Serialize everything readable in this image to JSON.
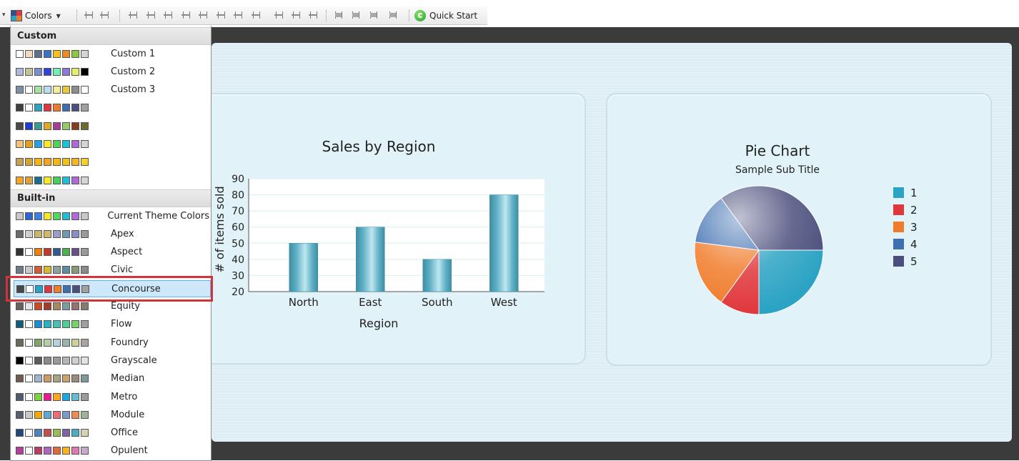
{
  "toolbar": {
    "colors_label": "Colors",
    "quick_start_label": "Quick Start"
  },
  "color_menu": {
    "custom_header": "Custom",
    "builtin_header": "Built-in",
    "custom": [
      {
        "label": "Custom 1",
        "colors": [
          "#ffffff",
          "#f5d9bd",
          "#5d7088",
          "#3a75c4",
          "#f5c21b",
          "#f08a22",
          "#8dc63f",
          "#d4d4d4"
        ]
      },
      {
        "label": "Custom 2",
        "colors": [
          "#b1b9d9",
          "#c3c39a",
          "#7a8fc7",
          "#2d44d7",
          "#6ff0b7",
          "#8e79d9",
          "#e5ef6b",
          "#000000"
        ]
      },
      {
        "label": "Custom 3",
        "colors": [
          "#7b8fa6",
          "#ffffff",
          "#a6e2a1",
          "#b8dff0",
          "#f3ee9a",
          "#e6c93f",
          "#8d8d8d",
          "#ffffff"
        ]
      },
      {
        "label": "",
        "colors": [
          "#404040",
          "#ffffff",
          "#2ba4c4",
          "#e0373c",
          "#f07c2b",
          "#3d6eb0",
          "#4c4f7d",
          "#a0a0a0"
        ]
      },
      {
        "label": "",
        "colors": [
          "#4a4a4a",
          "#1c3bd1",
          "#3a9b93",
          "#e0a82b",
          "#a93c97",
          "#9bc96a",
          "#8a3b1b",
          "#6f6a2d"
        ]
      },
      {
        "label": "",
        "colors": [
          "#f4c37a",
          "#e0a020",
          "#26a2e2",
          "#f8e829",
          "#4fd35a",
          "#19c3d8",
          "#b068d8",
          "#d4d4d4"
        ]
      },
      {
        "label": "",
        "colors": [
          "#c8a055",
          "#cfa537",
          "#f2b313",
          "#f5a31e",
          "#f5b90e",
          "#f2c11b",
          "#f5b720",
          "#f3d12a"
        ]
      },
      {
        "label": "",
        "colors": [
          "#f5a623",
          "#e0a03a",
          "#1b6e8e",
          "#f6e829",
          "#42d15a",
          "#1fc0d6",
          "#b068d8",
          "#d4d4d4"
        ]
      }
    ],
    "builtin": [
      {
        "label": "Current Theme Colors",
        "colors": [
          "#c9c9c9",
          "#2c67d1",
          "#3b82e5",
          "#f5e62a",
          "#52d85e",
          "#1fbfd8",
          "#b26ad8",
          "#c9c9c9"
        ]
      },
      {
        "label": "Apex",
        "colors": [
          "#6b6b6b",
          "#cfcfcf",
          "#c9b56b",
          "#ceb96b",
          "#9a9ec9",
          "#6d9ab0",
          "#8a8fc8",
          "#9a9a9a"
        ]
      },
      {
        "label": "Aspect",
        "colors": [
          "#333333",
          "#ffffff",
          "#f07f0a",
          "#c0392b",
          "#2b5e8e",
          "#4bb34b",
          "#6b4f86",
          "#9a9a9a"
        ]
      },
      {
        "label": "Civic",
        "colors": [
          "#6f7b8a",
          "#c9c9c9",
          "#d05c3c",
          "#d6b72e",
          "#8aa3a0",
          "#5b8fa0",
          "#899a76",
          "#8a8a8a"
        ]
      },
      {
        "label": "Concourse",
        "colors": [
          "#464646",
          "#ffffff",
          "#2ba3c4",
          "#e0373c",
          "#f07c2b",
          "#3d6eb0",
          "#4c4f7d",
          "#a0a0a0"
        ]
      },
      {
        "label": "Equity",
        "colors": [
          "#6b5e5e",
          "#e6e6e6",
          "#d2481e",
          "#a83a2a",
          "#a78860",
          "#7c9c9e",
          "#9a6f6f",
          "#8a7a6a"
        ]
      },
      {
        "label": "Flow",
        "colors": [
          "#0e5f7a",
          "#ffffff",
          "#1a8fd0",
          "#25b2c9",
          "#44c3b9",
          "#4bcf93",
          "#7ad36a",
          "#a0a0a0"
        ]
      },
      {
        "label": "Foundry",
        "colors": [
          "#6a6a5a",
          "#ffffff",
          "#7fa56a",
          "#b3d0a5",
          "#b3d4db",
          "#9ab5a9",
          "#cfcf9a",
          "#a9a4a0"
        ]
      },
      {
        "label": "Grayscale",
        "colors": [
          "#000000",
          "#ffffff",
          "#5a5a5a",
          "#8a8a8a",
          "#9a9a9a",
          "#b5b5b5",
          "#cfcfcf",
          "#e3e3e3"
        ]
      },
      {
        "label": "Median",
        "colors": [
          "#6f5a4f",
          "#ffffff",
          "#9fb5c8",
          "#d29a62",
          "#a6a67c",
          "#cca36b",
          "#9c8a7a",
          "#7f9a9a"
        ]
      },
      {
        "label": "Metro",
        "colors": [
          "#4f5a6f",
          "#ffffff",
          "#7fd142",
          "#e81a8d",
          "#fba51a",
          "#1aa8e0",
          "#60bdd0",
          "#9a9a9a"
        ]
      },
      {
        "label": "Module",
        "colors": [
          "#5a5f6f",
          "#c9c9c9",
          "#f0a80a",
          "#5ea9d0",
          "#ef6a7a",
          "#7a9ac9",
          "#ef8a52",
          "#9ab59a"
        ]
      },
      {
        "label": "Office",
        "colors": [
          "#1f497d",
          "#ffffff",
          "#4f81bd",
          "#c0504d",
          "#9bbb59",
          "#8064a2",
          "#4bacc6",
          "#d9d2b0"
        ]
      },
      {
        "label": "Opulent",
        "colors": [
          "#b13f9a",
          "#ffffff",
          "#b83d68",
          "#ac66bb",
          "#de6c36",
          "#f8b323",
          "#e07ab5",
          "#c9a9d0"
        ]
      }
    ],
    "selected": "Concourse"
  },
  "bar_panel": {
    "chart_data": {
      "type": "bar",
      "title": "Sales by Region",
      "xlabel": "Region",
      "ylabel": "# of items sold",
      "categories": [
        "North",
        "East",
        "South",
        "West"
      ],
      "values": [
        50,
        60,
        40,
        80
      ],
      "ylim": [
        20,
        90
      ],
      "yticks": [
        20,
        30,
        40,
        50,
        60,
        70,
        80,
        90
      ],
      "grid": true,
      "bar_color": "#5fb0c6"
    }
  },
  "pie_panel": {
    "chart_data": {
      "type": "pie",
      "title": "Pie Chart",
      "subtitle": "Sample Sub Title",
      "labels": [
        "1",
        "2",
        "3",
        "4",
        "5"
      ],
      "values": [
        25,
        10,
        17,
        13,
        35
      ],
      "colors": [
        "#2ba3c4",
        "#e0373c",
        "#f07c2b",
        "#3d6eb0",
        "#4c4f7d"
      ],
      "legend": "right"
    }
  }
}
